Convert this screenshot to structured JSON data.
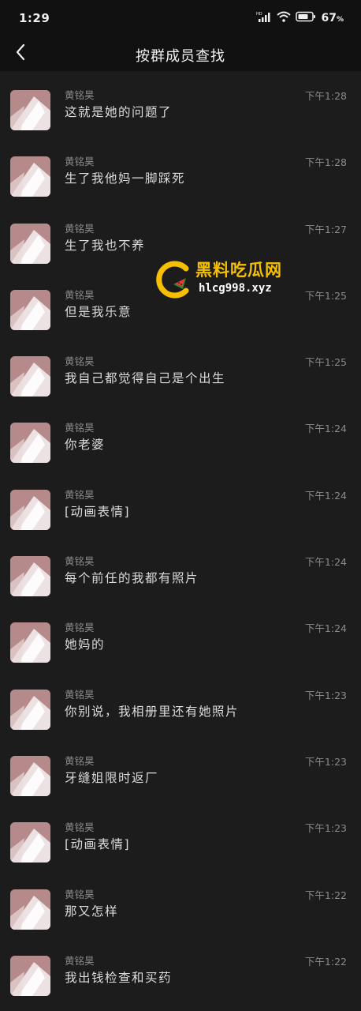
{
  "status_bar": {
    "time": "1:29",
    "battery_percent": "67",
    "battery_unit": "%"
  },
  "header": {
    "title": "按群成员查找"
  },
  "messages": [
    {
      "sender": "黄铭昊",
      "text": "这就是她的问题了",
      "time": "下午1:28"
    },
    {
      "sender": "黄铭昊",
      "text": "生了我他妈一脚踩死",
      "time": "下午1:28"
    },
    {
      "sender": "黄铭昊",
      "text": "生了我也不养",
      "time": "下午1:27"
    },
    {
      "sender": "黄铭昊",
      "text": "但是我乐意",
      "time": "下午1:25"
    },
    {
      "sender": "黄铭昊",
      "text": "我自己都觉得自己是个出生",
      "time": "下午1:25"
    },
    {
      "sender": "黄铭昊",
      "text": "你老婆",
      "time": "下午1:24"
    },
    {
      "sender": "黄铭昊",
      "text": "[动画表情]",
      "time": "下午1:24"
    },
    {
      "sender": "黄铭昊",
      "text": "每个前任的我都有照片",
      "time": "下午1:24"
    },
    {
      "sender": "黄铭昊",
      "text": "她妈的",
      "time": "下午1:24"
    },
    {
      "sender": "黄铭昊",
      "text": "你别说，我相册里还有她照片",
      "time": "下午1:23"
    },
    {
      "sender": "黄铭昊",
      "text": "牙缝姐限时返厂",
      "time": "下午1:23"
    },
    {
      "sender": "黄铭昊",
      "text": "[动画表情]",
      "time": "下午1:23"
    },
    {
      "sender": "黄铭昊",
      "text": "那又怎样",
      "time": "下午1:22"
    },
    {
      "sender": "黄铭昊",
      "text": "我出钱检查和买药",
      "time": "下午1:22"
    }
  ],
  "watermark": {
    "title": "黑料吃瓜网",
    "url": "hlcg998.xyz"
  },
  "colors": {
    "background": "#1c1c1c",
    "avatar": "#b6898a",
    "watermark_yellow": "#f6c000"
  }
}
